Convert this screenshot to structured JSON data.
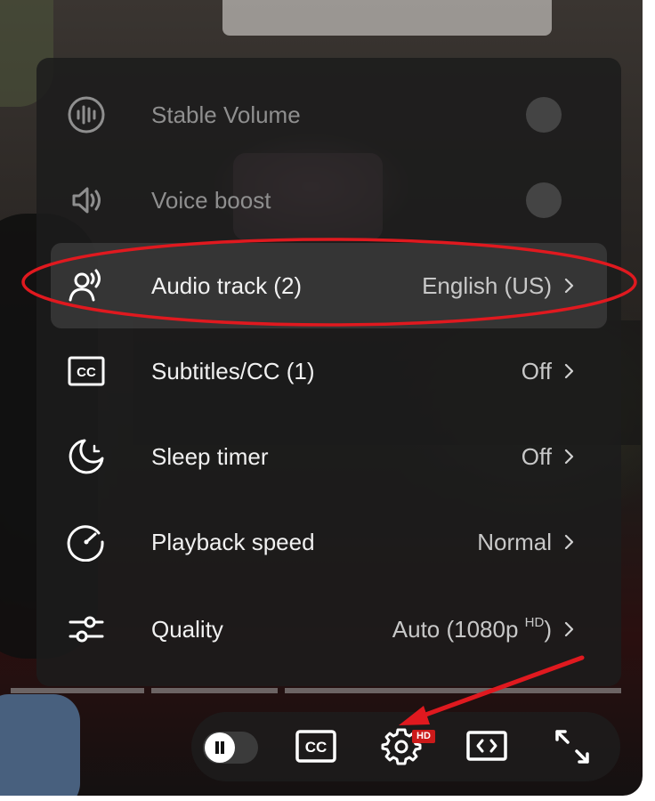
{
  "settings_menu": {
    "items": [
      {
        "label": "Stable Volume",
        "value": "",
        "icon": "stable-volume-icon",
        "control": "toggle",
        "enabled": false
      },
      {
        "label": "Voice boost",
        "value": "",
        "icon": "voice-boost-icon",
        "control": "toggle",
        "enabled": false
      },
      {
        "label": "Audio track (2)",
        "value": "English (US)",
        "icon": "audio-track-icon",
        "control": "submenu",
        "highlighted": true
      },
      {
        "label": "Subtitles/CC (1)",
        "value": "Off",
        "icon": "subtitles-icon",
        "control": "submenu"
      },
      {
        "label": "Sleep timer",
        "value": "Off",
        "icon": "sleep-timer-icon",
        "control": "submenu"
      },
      {
        "label": "Playback speed",
        "value": "Normal",
        "icon": "playback-speed-icon",
        "control": "submenu"
      },
      {
        "label": "Quality",
        "value": "Auto (1080p ",
        "value_sup": "HD",
        "value_suffix": ")",
        "icon": "quality-icon",
        "control": "submenu"
      }
    ]
  },
  "controls": {
    "play_state": "playing",
    "settings_badge": "HD",
    "buttons": [
      "pause-toggle",
      "subtitles",
      "settings",
      "theater-mode",
      "fullscreen"
    ]
  },
  "annotation": {
    "color": "#e0191f",
    "highlighted_item": "Audio track (2)",
    "arrow_target": "settings"
  }
}
